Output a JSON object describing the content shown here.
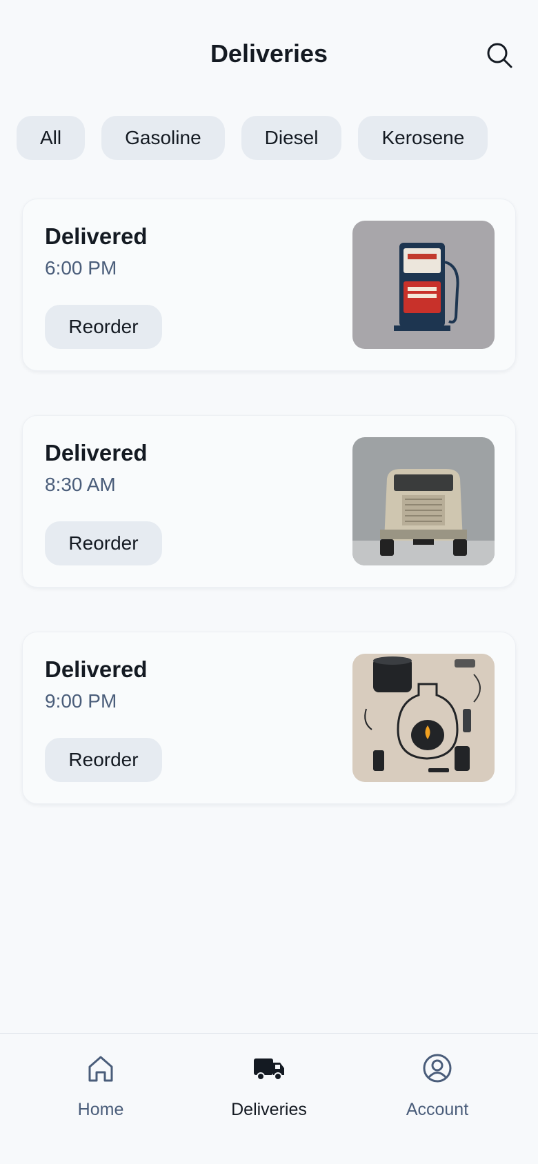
{
  "header": {
    "title": "Deliveries",
    "search_icon": "search-icon"
  },
  "filters": [
    "All",
    "Gasoline",
    "Diesel",
    "Kerosene"
  ],
  "deliveries": [
    {
      "status": "Delivered",
      "time": "6:00 PM",
      "action": "Reorder",
      "image": "gas-pump"
    },
    {
      "status": "Delivered",
      "time": "8:30 AM",
      "action": "Reorder",
      "image": "truck"
    },
    {
      "status": "Delivered",
      "time": "9:00 PM",
      "action": "Reorder",
      "image": "kerosene-lamp"
    }
  ],
  "nav": {
    "items": [
      {
        "label": "Home",
        "icon": "home-icon"
      },
      {
        "label": "Deliveries",
        "icon": "truck-icon",
        "active": true
      },
      {
        "label": "Account",
        "icon": "user-icon"
      }
    ]
  },
  "colors": {
    "background": "#f7f9fb",
    "chip": "#e6ebf1",
    "text": "#141a22",
    "muted": "#4a5d7a"
  }
}
